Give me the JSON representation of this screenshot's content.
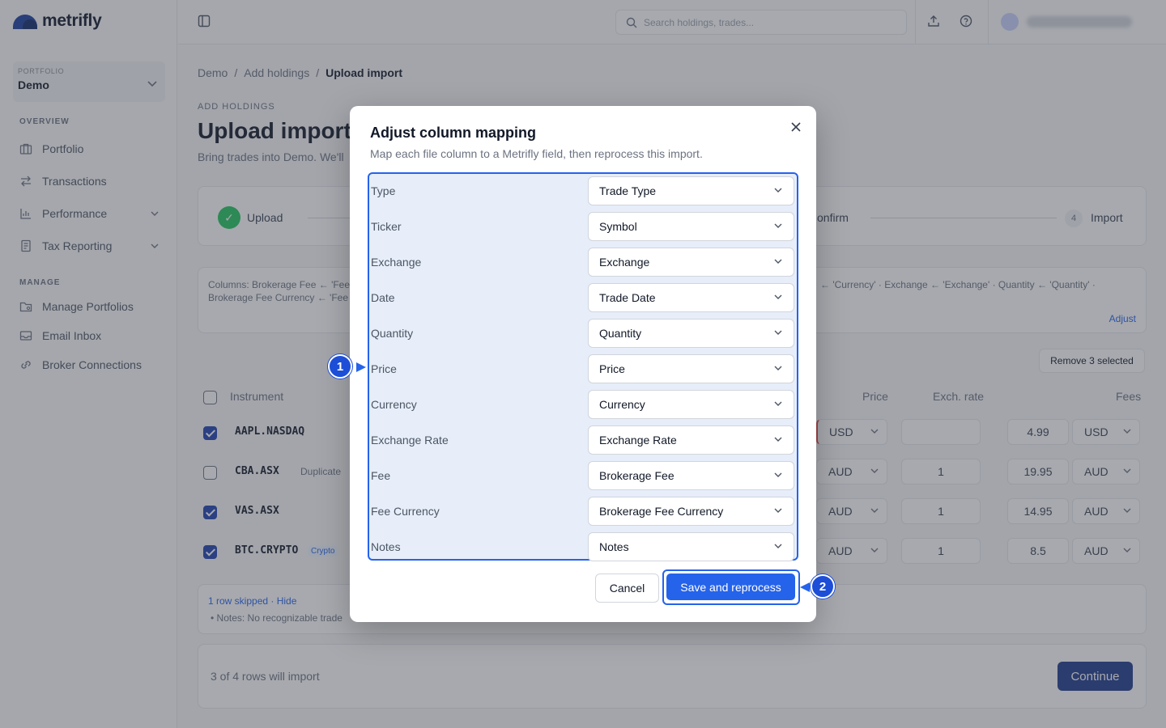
{
  "app": {
    "name": "metrifly"
  },
  "sidebar": {
    "portfolio_label": "PORTFOLIO",
    "portfolio_name": "Demo",
    "overview_label": "OVERVIEW",
    "overview_items": [
      "Portfolio",
      "Transactions",
      "Performance",
      "Tax Reporting"
    ],
    "manage_label": "MANAGE",
    "manage_items": [
      "Manage Portfolios",
      "Email Inbox",
      "Broker Connections"
    ]
  },
  "header": {
    "search_placeholder": "Search holdings, trades..."
  },
  "breadcrumb": [
    "Demo",
    "Add holdings",
    "Upload import"
  ],
  "page": {
    "eyebrow": "ADD HOLDINGS",
    "title": "Upload import",
    "subtitle": "Bring trades into Demo. We'll"
  },
  "stepper": {
    "step1": "Upload",
    "step3_partial": "onfirm",
    "step4_num": "4",
    "step4": "Import"
  },
  "columns_summary": {
    "left_line1": "Columns: Brokerage Fee ← 'Fee'",
    "left_line2": "Brokerage Fee Currency ← 'Fee",
    "right_line1": "← 'Currency' · Exchange ← 'Exchange' · Quantity ← 'Quantity' ·",
    "adjust": "Adjust"
  },
  "table": {
    "remove_selected": "Remove 3 selected",
    "headers": {
      "instrument": "Instrument",
      "price": "Price",
      "exch_rate": "Exch. rate",
      "fees": "Fees"
    },
    "rows": [
      {
        "ticker": "AAPL.NASDAQ",
        "tag": "",
        "checked": true,
        "currency": "USD",
        "rate": "",
        "fee": "4.99",
        "fee_currency": "USD"
      },
      {
        "ticker": "CBA.ASX",
        "tag": "Duplicate",
        "checked": false,
        "currency": "AUD",
        "rate": "1",
        "fee": "19.95",
        "fee_currency": "AUD"
      },
      {
        "ticker": "VAS.ASX",
        "tag": "",
        "checked": true,
        "currency": "AUD",
        "rate": "1",
        "fee": "14.95",
        "fee_currency": "AUD"
      },
      {
        "ticker": "BTC.CRYPTO",
        "tag": "Crypto",
        "checked": true,
        "currency": "AUD",
        "rate": "1",
        "fee": "8.5",
        "fee_currency": "AUD"
      }
    ],
    "skipped_link": "1 row skipped · Hide",
    "skipped_note": "• Notes: No recognizable trade"
  },
  "footer": {
    "summary": "3 of 4 rows will import",
    "continue": "Continue"
  },
  "modal": {
    "title": "Adjust column mapping",
    "subtitle": "Map each file column to a Metrifly field, then reprocess this import.",
    "mappings": [
      {
        "column": "Type",
        "field": "Trade Type"
      },
      {
        "column": "Ticker",
        "field": "Symbol"
      },
      {
        "column": "Exchange",
        "field": "Exchange"
      },
      {
        "column": "Date",
        "field": "Trade Date"
      },
      {
        "column": "Quantity",
        "field": "Quantity"
      },
      {
        "column": "Price",
        "field": "Price"
      },
      {
        "column": "Currency",
        "field": "Currency"
      },
      {
        "column": "Exchange Rate",
        "field": "Exchange Rate"
      },
      {
        "column": "Fee",
        "field": "Brokerage Fee"
      },
      {
        "column": "Fee Currency",
        "field": "Brokerage Fee Currency"
      },
      {
        "column": "Notes",
        "field": "Notes"
      }
    ],
    "cancel": "Cancel",
    "save": "Save and reprocess"
  },
  "annotations": {
    "marker1": "1",
    "marker2": "2"
  },
  "colors": {
    "accent": "#2563eb",
    "brand": "#1a3f9e"
  }
}
